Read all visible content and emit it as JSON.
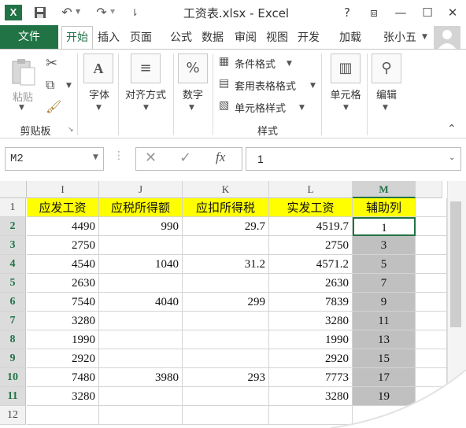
{
  "titlebar": {
    "app_icon": "X",
    "title": "工资表.xlsx - Excel",
    "icons": [
      "save-icon",
      "undo-icon",
      "redo-icon",
      "customize-icon"
    ],
    "help": "?",
    "restore": "⧈",
    "minimize": "—",
    "maximize": "☐",
    "close": "✕"
  },
  "tabs": {
    "file": "文件",
    "items": [
      "开始",
      "插入",
      "页面",
      "公式",
      "数据",
      "审阅",
      "视图",
      "开发",
      "加载"
    ],
    "user": "张小五"
  },
  "ribbon": {
    "paste": "粘贴",
    "clipboard_group": "剪贴板",
    "font": "字体",
    "align": "对齐方式",
    "number": "数字",
    "cond_format": "条件格式",
    "table_format": "套用表格格式",
    "cell_style": "单元格样式",
    "styles_group": "样式",
    "cells": "单元格",
    "edit": "编辑"
  },
  "formula_bar": {
    "name_box": "M2",
    "fx": "fx",
    "value": "1"
  },
  "sheet": {
    "columns": [
      "I",
      "J",
      "K",
      "L",
      "M"
    ],
    "rows": [
      "1",
      "2",
      "3",
      "4",
      "5",
      "6",
      "7",
      "8",
      "9",
      "10",
      "11",
      "12"
    ],
    "headers": [
      "应发工资",
      "应税所得额",
      "应扣所得税",
      "实发工资",
      "辅助列"
    ],
    "data": [
      [
        "4490",
        "990",
        "29.7",
        "4519.7",
        "1"
      ],
      [
        "2750",
        "",
        "",
        "2750",
        "3"
      ],
      [
        "4540",
        "1040",
        "31.2",
        "4571.2",
        "5"
      ],
      [
        "2630",
        "",
        "",
        "2630",
        "7"
      ],
      [
        "7540",
        "4040",
        "299",
        "7839",
        "9"
      ],
      [
        "3280",
        "",
        "",
        "3280",
        "11"
      ],
      [
        "1990",
        "",
        "",
        "1990",
        "13"
      ],
      [
        "2920",
        "",
        "",
        "2920",
        "15"
      ],
      [
        "7480",
        "3980",
        "293",
        "7773",
        "17"
      ],
      [
        "3280",
        "",
        "",
        "3280",
        "19"
      ]
    ]
  },
  "colors": {
    "accent": "#217346",
    "header_fill": "#ffff00",
    "aux_fill": "#c0c0c0"
  }
}
